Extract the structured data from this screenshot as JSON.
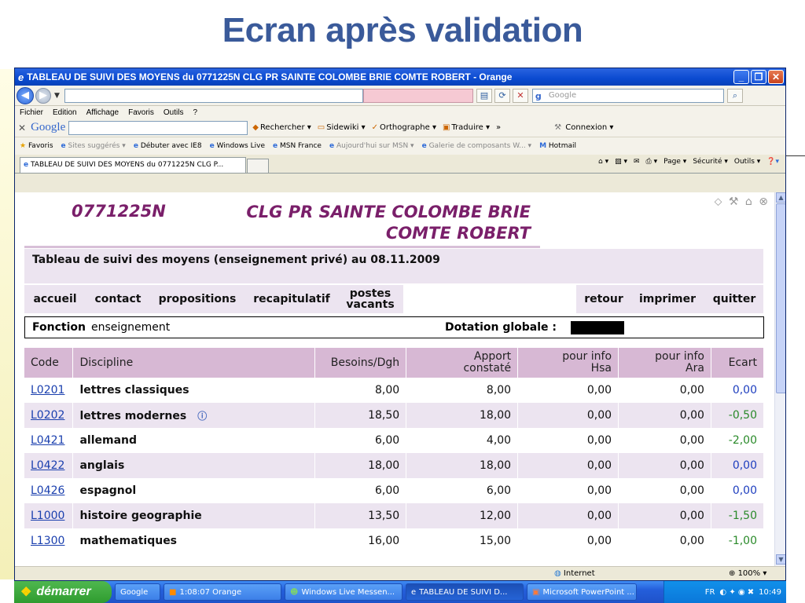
{
  "slide": {
    "title": "Ecran après validation"
  },
  "browser": {
    "window_title": "TABLEAU DE SUIVI DES MOYENS du 0771225N  CLG PR SAINTE COLOMBE BRIE COMTE ROBERT - Orange",
    "search_placeholder": "Google",
    "menu": [
      "Fichier",
      "Edition",
      "Affichage",
      "Favoris",
      "Outils",
      "?"
    ],
    "google_toolbar": {
      "logo": "Google",
      "items": [
        "Rechercher ▾",
        "Sidewiki ▾",
        "Orthographe ▾",
        "Traduire ▾",
        "»",
        "Connexion ▾"
      ]
    },
    "favorites": {
      "label": "Favoris",
      "items": [
        {
          "label": "Sites suggérés ▾",
          "dim": true
        },
        {
          "label": "Débuter avec IE8",
          "dim": false
        },
        {
          "label": "Windows Live",
          "dim": false
        },
        {
          "label": "MSN France",
          "dim": false
        },
        {
          "label": "Aujourd'hui sur MSN ▾",
          "dim": true
        },
        {
          "label": "Galerie de composants W... ▾",
          "dim": true
        },
        {
          "label": "Hotmail",
          "dim": false
        }
      ]
    },
    "tab_title": "TABLEAU DE SUIVI DES MOYENS du 0771225N  CLG P...",
    "tab_tools": [
      "Page ▾",
      "Sécurité ▾",
      "Outils ▾"
    ],
    "status_zone": "Internet",
    "zoom": "100%"
  },
  "page": {
    "school_code": "0771225N",
    "school_name": "CLG PR SAINTE COLOMBE BRIE COMTE ROBERT",
    "subtitle": "Tableau de suivi des moyens (enseignement privé) au 08.11.2009",
    "nav": {
      "accueil": "accueil",
      "contact": "contact",
      "propositions": "propositions",
      "recapitulatif": "recapitulatif",
      "postes_vacants": "postes vacants",
      "retour": "retour",
      "imprimer": "imprimer",
      "quitter": "quitter"
    },
    "fonction_label": "Fonction",
    "fonction_sep": " : ",
    "fonction_value": "enseignement",
    "dotation_label": "Dotation globale  :",
    "table": {
      "headers": [
        "Code",
        "Discipline",
        "Besoins/Dgh",
        "Apport constaté",
        "pour info Hsa",
        "pour info Ara",
        "Ecart"
      ],
      "rows": [
        {
          "code": "L0201",
          "discipline": "lettres classiques",
          "besoins": "8,00",
          "apport": "8,00",
          "hsa": "0,00",
          "ara": "0,00",
          "ecart": "0,00",
          "ecart_color": "#1f3fbf",
          "info": false
        },
        {
          "code": "L0202",
          "discipline": "lettres modernes",
          "besoins": "18,50",
          "apport": "18,00",
          "hsa": "0,00",
          "ara": "0,00",
          "ecart": "-0,50",
          "ecart_color": "#2a8a2a",
          "info": true
        },
        {
          "code": "L0421",
          "discipline": "allemand",
          "besoins": "6,00",
          "apport": "4,00",
          "hsa": "0,00",
          "ara": "0,00",
          "ecart": "-2,00",
          "ecart_color": "#2a8a2a",
          "info": false
        },
        {
          "code": "L0422",
          "discipline": "anglais",
          "besoins": "18,00",
          "apport": "18,00",
          "hsa": "0,00",
          "ara": "0,00",
          "ecart": "0,00",
          "ecart_color": "#1f3fbf",
          "info": false
        },
        {
          "code": "L0426",
          "discipline": "espagnol",
          "besoins": "6,00",
          "apport": "6,00",
          "hsa": "0,00",
          "ara": "0,00",
          "ecart": "0,00",
          "ecart_color": "#1f3fbf",
          "info": false
        },
        {
          "code": "L1000",
          "discipline": "histoire geographie",
          "besoins": "13,50",
          "apport": "12,00",
          "hsa": "0,00",
          "ara": "0,00",
          "ecart": "-1,50",
          "ecart_color": "#2a8a2a",
          "info": false
        },
        {
          "code": "L1300",
          "discipline": "mathematiques",
          "besoins": "16,00",
          "apport": "15,00",
          "hsa": "0,00",
          "ara": "0,00",
          "ecart": "-1,00",
          "ecart_color": "#2a8a2a",
          "info": false
        }
      ]
    }
  },
  "taskbar": {
    "start": "démarrer",
    "tasks": [
      "Google",
      "1:08:07 Orange",
      "Windows Live Messen...",
      "TABLEAU DE SUIVI D...",
      "Microsoft PowerPoint ..."
    ],
    "active_task": 3,
    "lang": "FR",
    "clock": "10:49"
  },
  "colors": {
    "title_blue": "#3a5a9a",
    "school_purple": "#7a1f6a",
    "header_mauve": "#d7b8d4",
    "band_lilac": "#ece4f0",
    "ecart_zero": "#1f3fbf",
    "ecart_negative": "#2a8a2a"
  }
}
